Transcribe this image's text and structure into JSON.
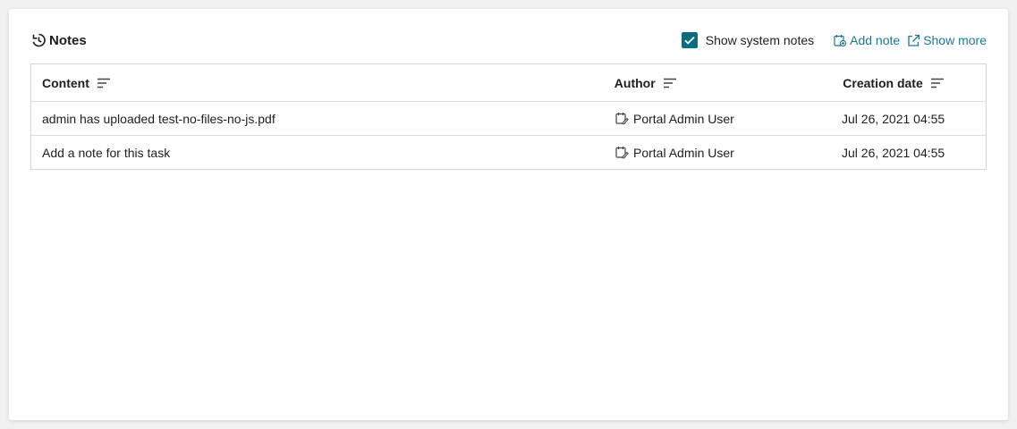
{
  "header": {
    "title": "Notes",
    "title_icon": "history-icon",
    "show_system_notes_label": "Show system notes",
    "show_system_notes_checked": true,
    "add_note_label": "Add note",
    "show_more_label": "Show more"
  },
  "colors": {
    "accent": "#0d6b7e",
    "link": "#1a7a93"
  },
  "table": {
    "columns": [
      "Content",
      "Author",
      "Creation date"
    ],
    "rows": [
      {
        "content": "admin has uploaded test-no-files-no-js.pdf",
        "author": "Portal Admin User",
        "date": "Jul 26, 2021 04:55"
      },
      {
        "content": "Add a note for this task",
        "author": "Portal Admin User",
        "date": "Jul 26, 2021 04:55"
      }
    ]
  }
}
